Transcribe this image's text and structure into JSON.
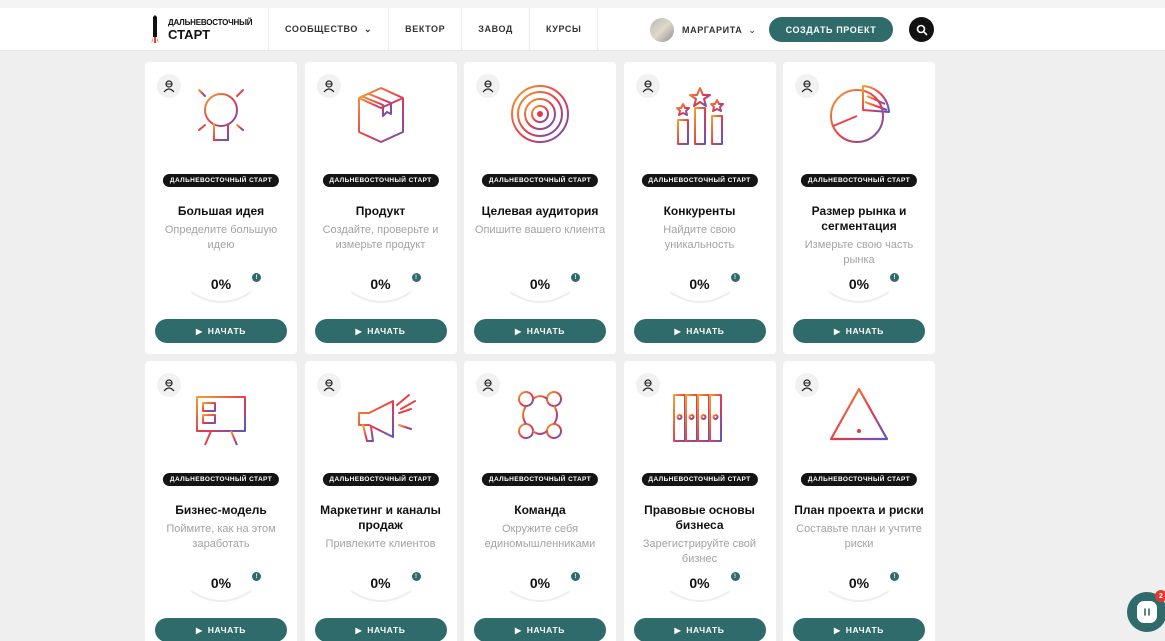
{
  "header": {
    "logo_line1": "ДАЛЬНЕВОСТОЧНЫЙ",
    "logo_line2": "СТАРТ",
    "nav": [
      {
        "label": "СООБЩЕСТВО",
        "has_dropdown": true
      },
      {
        "label": "ВЕКТОР",
        "has_dropdown": false
      },
      {
        "label": "ЗАВОД",
        "has_dropdown": false
      },
      {
        "label": "КУРСЫ",
        "has_dropdown": false
      }
    ],
    "user_name": "МАРГАРИТА",
    "create_button": "СОЗДАТЬ ПРОЕКТ",
    "search_icon": "search-icon"
  },
  "colors": {
    "accent": "#2e6b6a",
    "badge_bg": "#141414",
    "illustration_gradient": [
      "#f0a030",
      "#e5394a",
      "#5a55c8"
    ]
  },
  "cards": [
    {
      "icon": "lightbulb-icon",
      "badge": "ДАЛЬНЕВОСТОЧНЫЙ СТАРТ",
      "title": "Большая идея",
      "desc": "Определите большую идею",
      "progress": "0%",
      "button": "НАЧАТЬ"
    },
    {
      "icon": "box-icon",
      "badge": "ДАЛЬНЕВОСТОЧНЫЙ СТАРТ",
      "title": "Продукт",
      "desc": "Создайте, проверьте и измерьте продукт",
      "progress": "0%",
      "button": "НАЧАТЬ"
    },
    {
      "icon": "target-icon",
      "badge": "ДАЛЬНЕВОСТОЧНЫЙ СТАРТ",
      "title": "Целевая аудитория",
      "desc": "Опишите вашего клиента",
      "progress": "0%",
      "button": "НАЧАТЬ"
    },
    {
      "icon": "stars-podium-icon",
      "badge": "ДАЛЬНЕВОСТОЧНЫЙ СТАРТ",
      "title": "Конкуренты",
      "desc": "Найдите свою уникальность",
      "progress": "0%",
      "button": "НАЧАТЬ"
    },
    {
      "icon": "pie-chart-icon",
      "badge": "ДАЛЬНЕВОСТОЧНЫЙ СТАРТ",
      "title": "Размер рынка и сегментация",
      "desc": "Измерьте свою часть рынка",
      "progress": "0%",
      "button": "НАЧАТЬ"
    },
    {
      "icon": "presentation-board-icon",
      "badge": "ДАЛЬНЕВОСТОЧНЫЙ СТАРТ",
      "title": "Бизнес-модель",
      "desc": "Поймите, как на этом заработать",
      "progress": "0%",
      "button": "НАЧАТЬ"
    },
    {
      "icon": "megaphone-icon",
      "badge": "ДАЛЬНЕВОСТОЧНЫЙ СТАРТ",
      "title": "Маркетинг и каналы продаж",
      "desc": "Привлеките клиентов",
      "progress": "0%",
      "button": "НАЧАТЬ"
    },
    {
      "icon": "team-nodes-icon",
      "badge": "ДАЛЬНЕВОСТОЧНЫЙ СТАРТ",
      "title": "Команда",
      "desc": "Окружите себя единомышленниками",
      "progress": "0%",
      "button": "НАЧАТЬ"
    },
    {
      "icon": "binders-icon",
      "badge": "ДАЛЬНЕВОСТОЧНЫЙ СТАРТ",
      "title": "Правовые основы бизнеса",
      "desc": "Зарегистрируйте свой бизнес",
      "progress": "0%",
      "button": "НАЧАТЬ"
    },
    {
      "icon": "warning-triangle-icon",
      "badge": "ДАЛЬНЕВОСТОЧНЫЙ СТАРТ",
      "title": "План проекта и риски",
      "desc": "Составьте план и учтите риски",
      "progress": "0%",
      "button": "НАЧАТЬ"
    }
  ],
  "chat": {
    "unread": "2"
  }
}
